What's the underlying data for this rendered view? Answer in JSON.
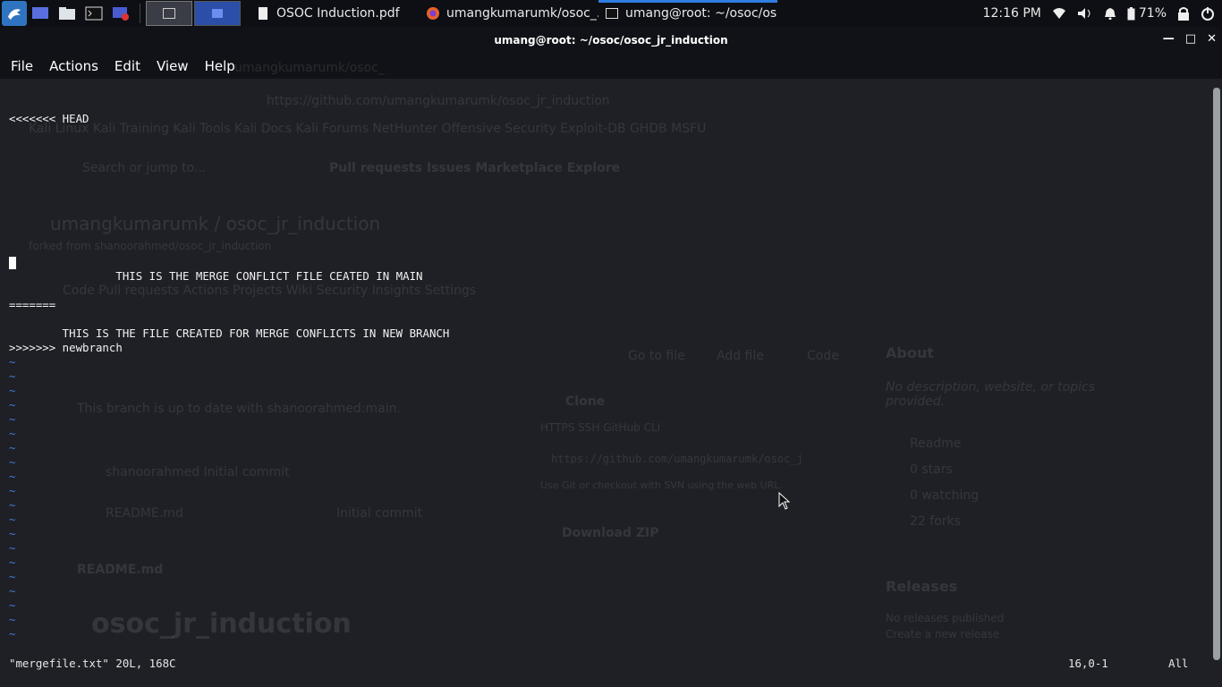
{
  "taskbar": {
    "tasks": [
      {
        "label": "OSOC Induction.pdf",
        "icon": "document-icon"
      },
      {
        "label": "umangkumarumk/osoc_...",
        "icon": "firefox-icon"
      },
      {
        "label": "umang@root: ~/osoc/os...",
        "icon": "terminal-icon"
      }
    ],
    "clock": "12:16 PM",
    "battery": "71%"
  },
  "window": {
    "title": "umang@root: ~/osoc/osoc_jr_induction",
    "menu": [
      "File",
      "Actions",
      "Edit",
      "View",
      "Help"
    ]
  },
  "terminal": {
    "line_head": "<<<<<<< HEAD",
    "line_main": "                THIS IS THE MERGE CONFLICT FILE CEATED IN MAIN",
    "line_sep": "=======",
    "line_branch": "        THIS IS THE FILE CREATED FOR MERGE CONFLICTS IN NEW BRANCH",
    "line_tail": ">>>>>>> newbranch",
    "tilde": "~",
    "status_file": "\"mergefile.txt\" 20L, 168C",
    "status_pos": "16,0-1",
    "status_all": "All"
  },
  "ghost": {
    "tab": "umangkumarumk/osoc_",
    "url": "https://github.com/umangkumarumk/osoc_jr_induction",
    "bookmarks": "Kali Linux   Kali Training   Kali Tools   Kali Docs   Kali Forums   NetHunter   Offensive Security   Exploit-DB   GHDB   MSFU",
    "search": "Search or jump to...",
    "nav": "Pull requests   Issues   Marketplace   Explore",
    "repo": "umangkumarumk / osoc_jr_induction",
    "forked": "forked from shanoorahmed/osoc_jr_induction",
    "tabs": "Code   Pull requests   Actions   Projects   Wiki   Security   Insights   Settings",
    "uptodate": "This branch is up to date with shanoorahmed:main.",
    "commit": "shanoorahmed Initial commit",
    "readme_file": "README.md",
    "readme_msg": "Initial commit",
    "readme_title": "README.md",
    "big": "osoc_jr_induction",
    "clone": "Clone",
    "clone_tabs": "HTTPS   SSH   GitHub CLI",
    "clone_url": "https://github.com/umangkumarumk/osoc_j",
    "clone_hint": "Use Git or checkout with SVN using the web URL.",
    "zip": "Download ZIP",
    "goto": "Go to file",
    "addfile": "Add file",
    "code_btn": "Code",
    "about": "About",
    "about_desc": "No description, website, or topics provided.",
    "about_items": [
      "Readme",
      "0 stars",
      "0 watching",
      "22 forks"
    ],
    "releases": "Releases",
    "releases_desc": "No releases published",
    "releases_link": "Create a new release"
  }
}
